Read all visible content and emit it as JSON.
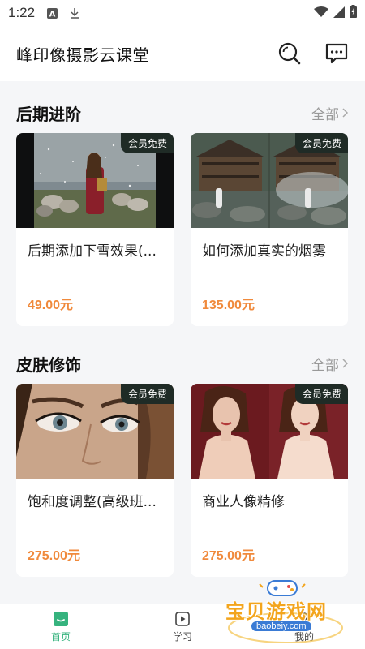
{
  "status_bar": {
    "time": "1:22",
    "left_icons": [
      "a-badge-icon",
      "download-icon"
    ],
    "right_icons": [
      "wifi-icon",
      "signal-icon",
      "battery-icon"
    ]
  },
  "header": {
    "title": "峰印像摄影云课堂",
    "icons": [
      "search-icon",
      "message-icon"
    ]
  },
  "sections": [
    {
      "title": "后期进阶",
      "more": "全部",
      "courses": [
        {
          "badge": "会员免费",
          "title": "后期添加下雪效果(...",
          "price": "49.00元",
          "thumb": "snow-shepherd-photo"
        },
        {
          "badge": "会员免费",
          "title": "如何添加真实的烟雾",
          "price": "135.00元",
          "thumb": "wooden-house-fog-photo"
        }
      ]
    },
    {
      "title": "皮肤修饰",
      "more": "全部",
      "courses": [
        {
          "badge": "会员免费",
          "title": "饱和度调整(高级班...",
          "price": "275.00元",
          "thumb": "eye-closeup-photo"
        },
        {
          "badge": "会员免费",
          "title": "商业人像精修",
          "price": "275.00元",
          "thumb": "portrait-retouch-photo"
        }
      ]
    }
  ],
  "tabbar": {
    "tabs": [
      {
        "label": "首页",
        "icon": "home-icon",
        "active": true
      },
      {
        "label": "学习",
        "icon": "play-icon",
        "active": false
      },
      {
        "label": "我的",
        "icon": "user-icon",
        "active": false
      }
    ]
  },
  "watermark": {
    "text": "宝贝游戏网",
    "sub": "baobeiy.com"
  },
  "colors": {
    "accent": "#36b37e",
    "price": "#f08a3c",
    "badge_bg": "#1f2b26"
  }
}
